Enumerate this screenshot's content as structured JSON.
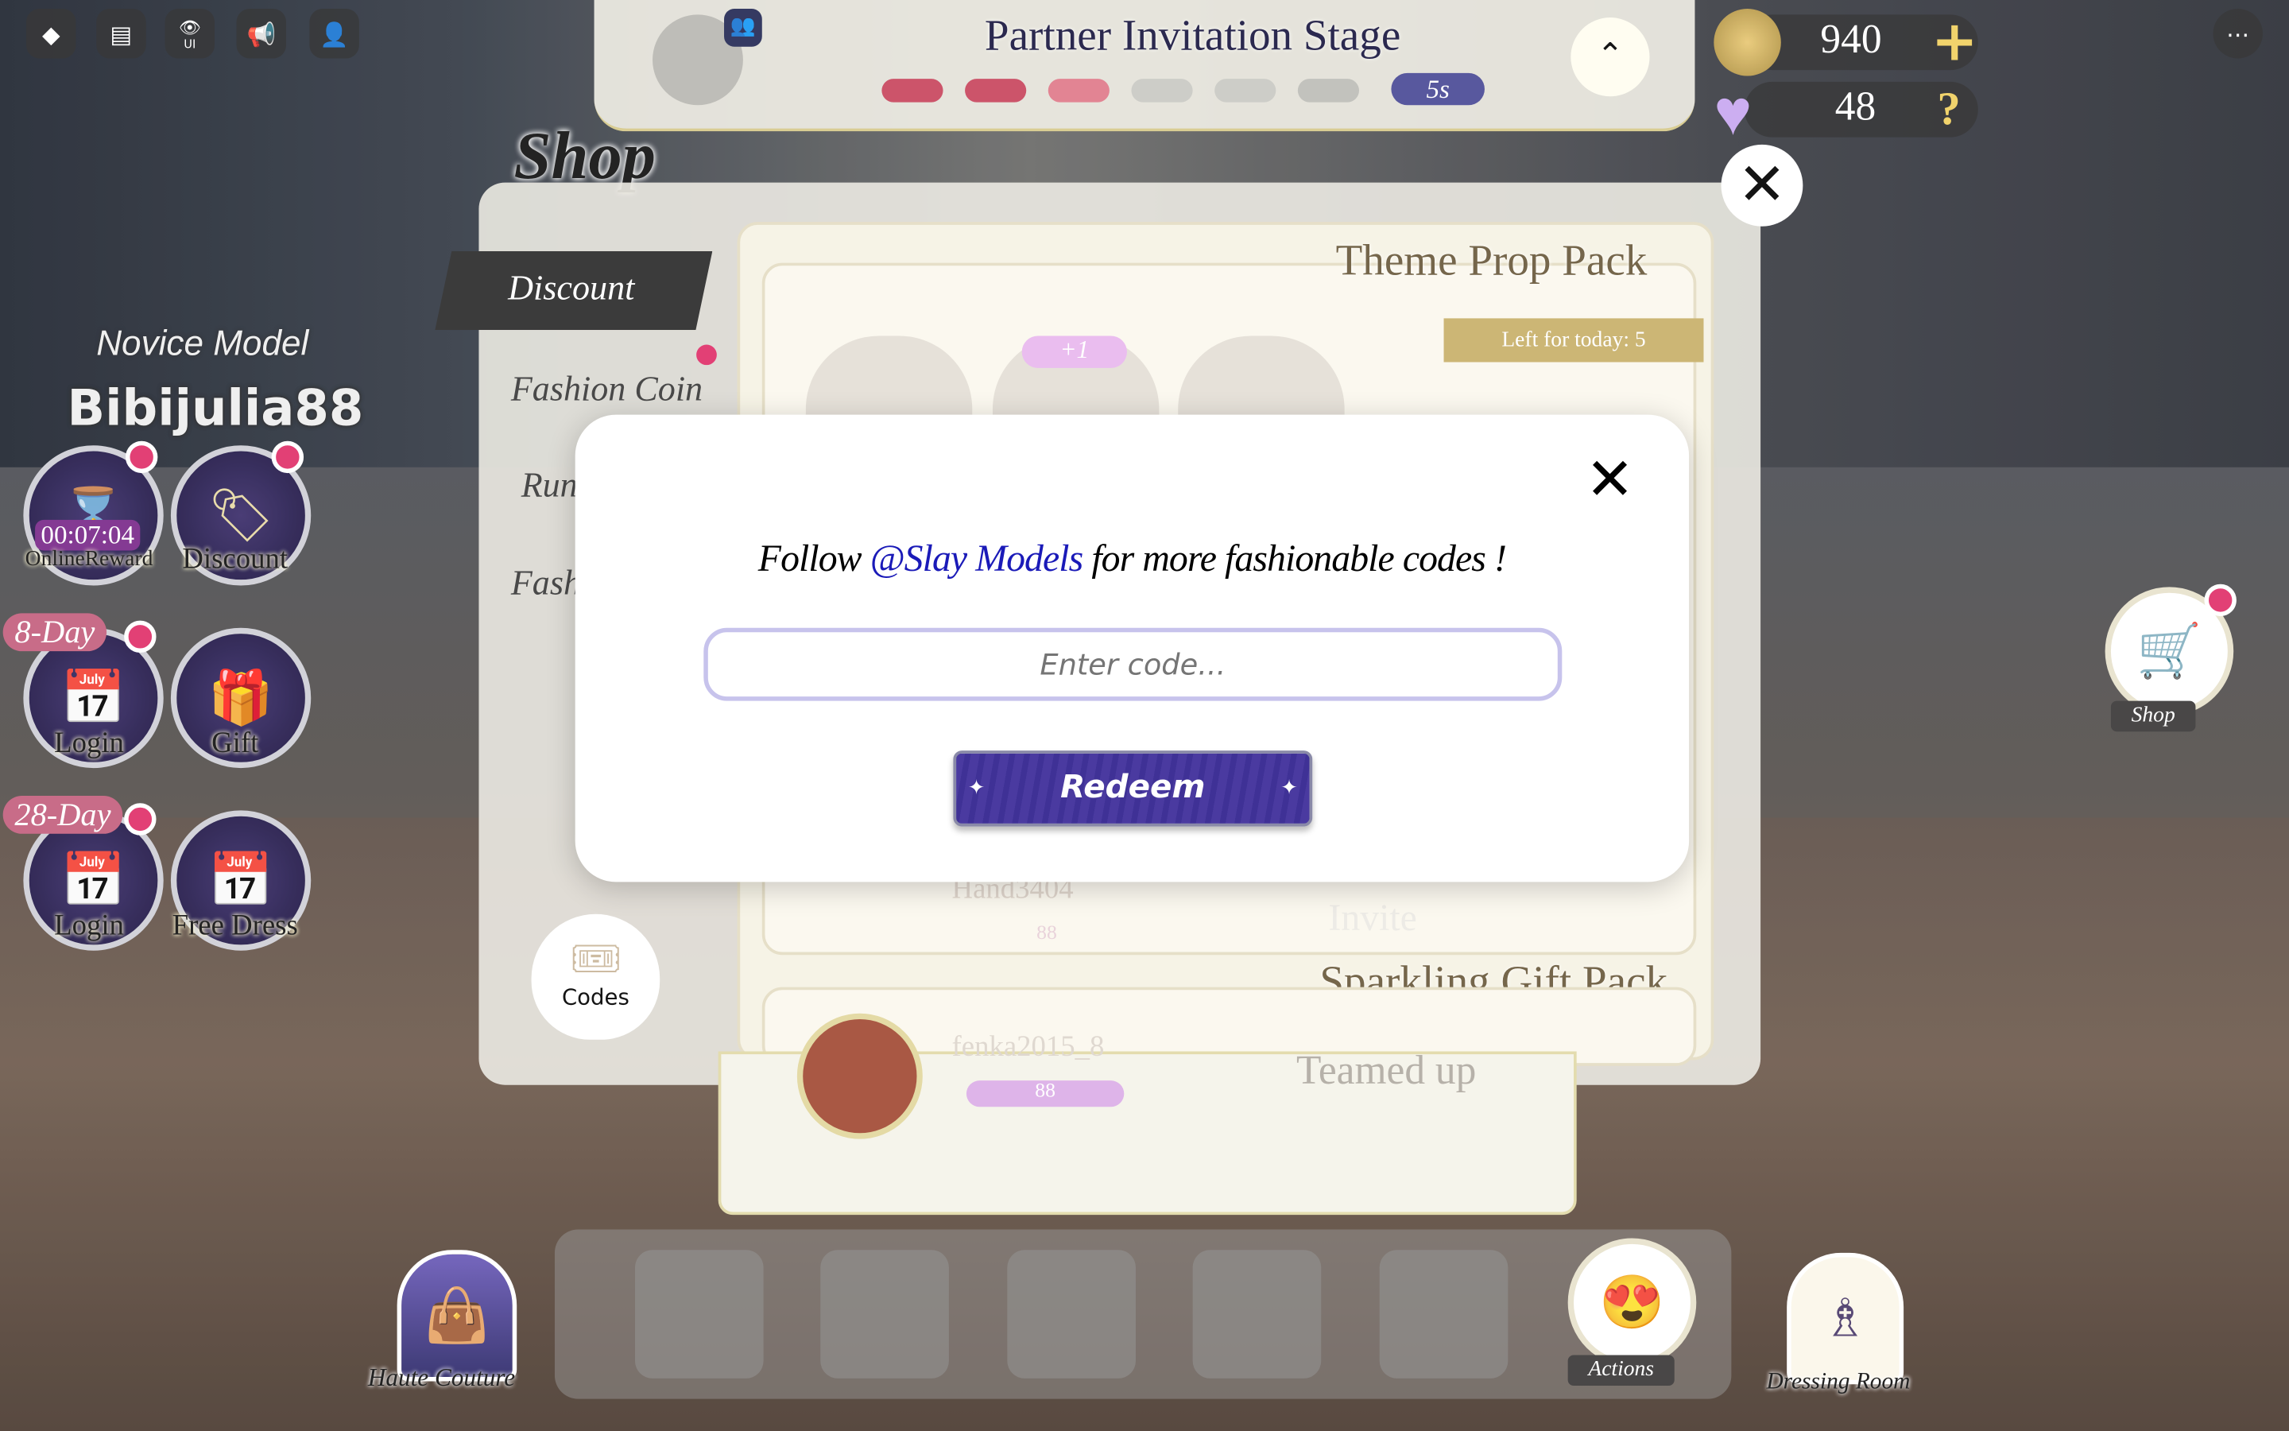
{
  "topbar": {
    "icons": [
      "roblox-logo-icon",
      "chat-icon",
      "ui-toggle-icon",
      "megaphone-icon",
      "add-friend-icon"
    ],
    "ui_label": "UI"
  },
  "stage": {
    "title": "Partner Invitation Stage",
    "timer": "5s",
    "progress_filled": 3,
    "progress_total": 6,
    "colors": {
      "filled": "#c8465e",
      "light": "#e07a8a",
      "empty": "#c9c9c4",
      "timer": "#4a4a96"
    }
  },
  "currency": {
    "coins": "940",
    "gems": "48",
    "add_label": "+",
    "help_label": "?"
  },
  "shop": {
    "title": "Shop",
    "tabs": [
      "Discount",
      "Fashion Coin",
      "Run",
      "Fash"
    ],
    "codes_label": "Codes",
    "theme_pack_title": "Theme Prop Pack",
    "left_for_today": "Left for today: 5",
    "gift_badge": "+1",
    "sparkling_title": "Sparkling Gift Pack"
  },
  "background_list": {
    "row1_name": "Hand3404",
    "row1_value": "88",
    "row1_action": "Invite",
    "row2_name": "fenka2015_8",
    "row2_value": "88",
    "row2_status": "Teamed up"
  },
  "player": {
    "rank": "Novice Model",
    "name": "Bibijulia88"
  },
  "side_buttons": [
    {
      "label": "OnlineReward",
      "timer": "00:07:04"
    },
    {
      "label": "Discount"
    },
    {
      "label": "Login",
      "tag": "8-Day"
    },
    {
      "label": "Gift"
    },
    {
      "label": "Login",
      "tag": "28-Day"
    },
    {
      "label": "Free Dress"
    }
  ],
  "right": {
    "shop_label": "Shop"
  },
  "bottom": {
    "haute_couture": "Haute Couture",
    "actions": "Actions",
    "dressing_room": "Dressing Room"
  },
  "dialog": {
    "text_before": "Follow ",
    "handle": "@Slay Models",
    "text_after": " for more fashionable codes !",
    "placeholder": "Enter code...",
    "value": "",
    "redeem_label": "Redeem",
    "accent": "#3a2a8c",
    "handle_color": "#1a1ab8"
  }
}
